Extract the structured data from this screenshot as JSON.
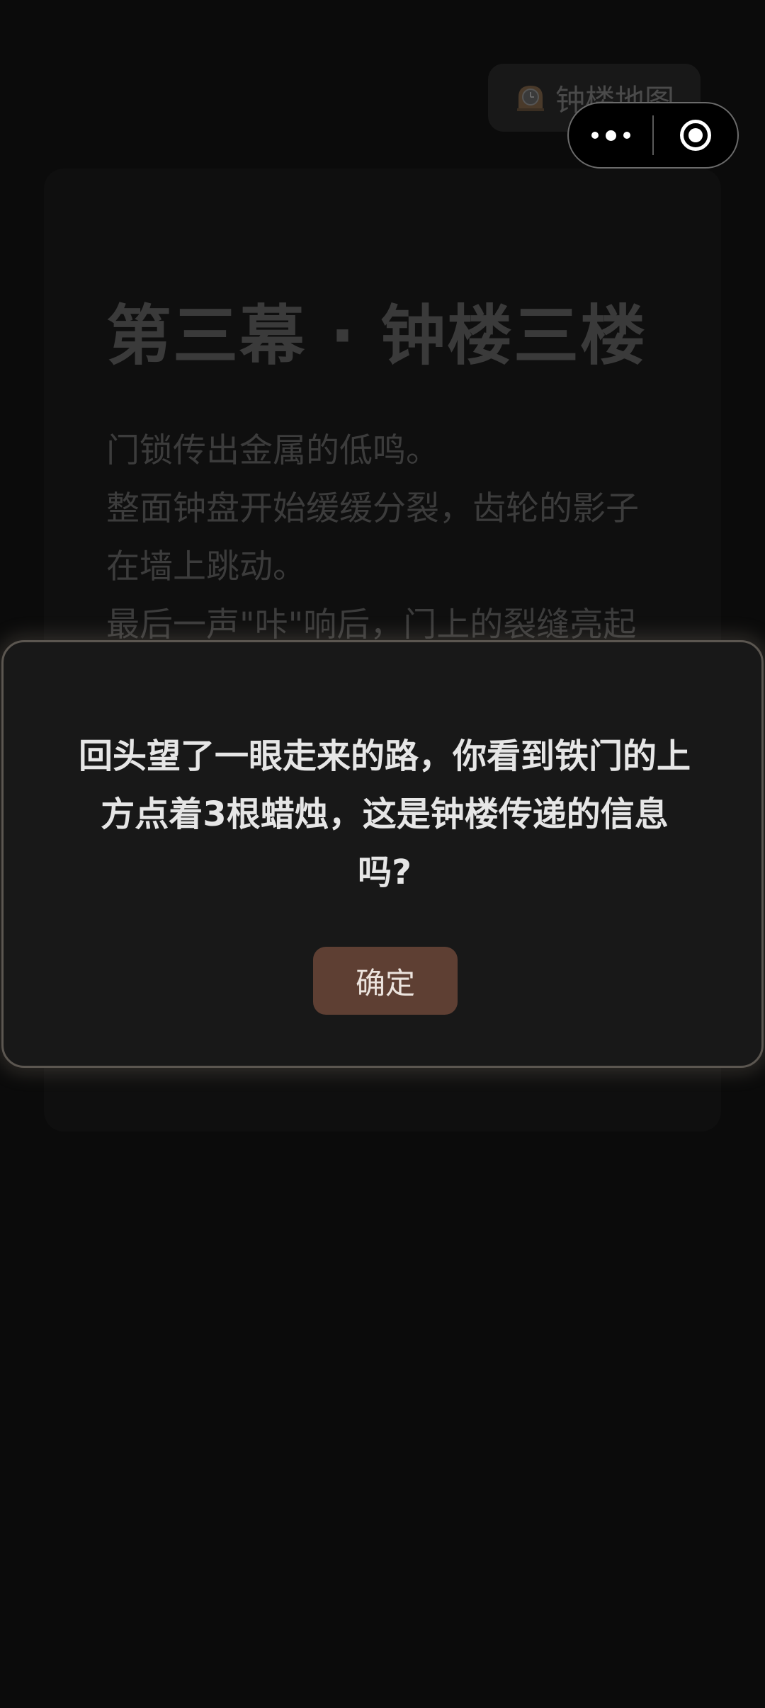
{
  "top_bar": {
    "map_button_label": "钟楼地图",
    "map_icon": "mantel-clock-icon"
  },
  "capsule": {
    "more_icon": "more-dots-icon",
    "close_icon": "target-close-icon"
  },
  "story": {
    "title": "第三幕 · 钟楼三楼",
    "lines": [
      "门锁传出金属的低鸣。",
      "整面钟盘开始缓缓分裂，齿轮的影子",
      "在墙上跳动。",
      "最后一声\"咔\"响后，门上的裂缝亮起"
    ]
  },
  "dialog": {
    "message": "回头望了一眼走来的路，你看到铁门的上方点着3根蜡烛，这是钟楼传递的信息吗?",
    "confirm_label": "确定"
  },
  "colors": {
    "background": "#0b0b0b",
    "dialog_bg": "#181818",
    "confirm_button": "#5e3f33",
    "dim_text": "#3c3c3c"
  }
}
